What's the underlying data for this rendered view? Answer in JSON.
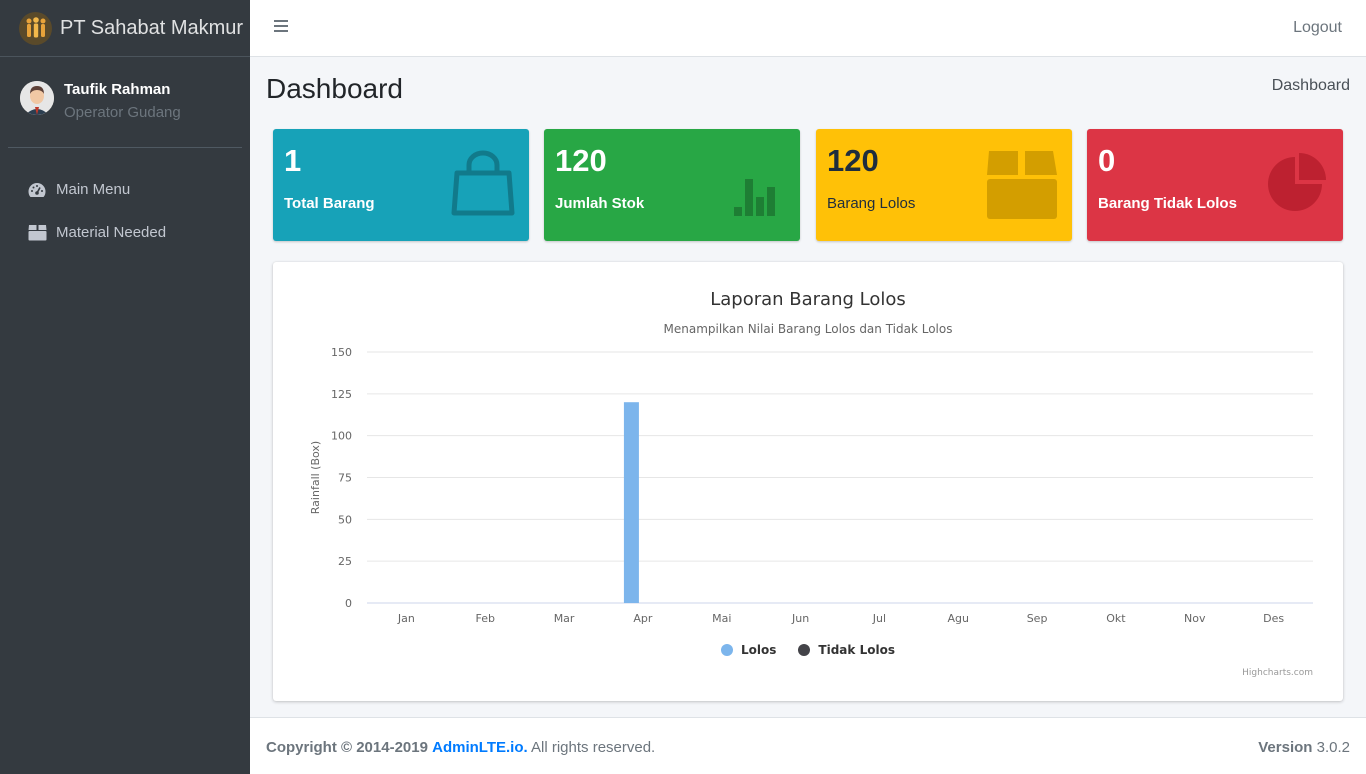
{
  "brand": {
    "name": "PT Sahabat Makmur",
    "logo_icon": "people-group-icon"
  },
  "user": {
    "name": "Taufik Rahman",
    "role": "Operator Gudang"
  },
  "sidebar": {
    "items": [
      {
        "label": "Main Menu",
        "icon": "tachometer-icon"
      },
      {
        "label": "Material Needed",
        "icon": "box-icon"
      }
    ]
  },
  "header": {
    "logout_label": "Logout",
    "menu_icon": "hamburger-icon"
  },
  "page": {
    "title": "Dashboard",
    "breadcrumb": "Dashboard"
  },
  "stats": [
    {
      "value": "1",
      "label": "Total Barang",
      "color": "#17a2b8",
      "icon": "shopping-bag-icon"
    },
    {
      "value": "120",
      "label": "Jumlah Stok",
      "color": "#28a745",
      "icon": "bar-chart-icon"
    },
    {
      "value": "120",
      "label": "Barang Lolos",
      "color": "#ffc107",
      "icon": "archive-box-icon"
    },
    {
      "value": "0",
      "label": "Barang Tidak Lolos",
      "color": "#dc3545",
      "icon": "pie-chart-icon"
    }
  ],
  "chart_data": {
    "type": "bar",
    "title": "Laporan Barang Lolos",
    "subtitle": "Menampilkan Nilai Barang Lolos dan Tidak Lolos",
    "ylabel": "Rainfall (Box)",
    "xlabel": "",
    "ylim": [
      0,
      150
    ],
    "yticks": [
      0,
      25,
      50,
      75,
      100,
      125,
      150
    ],
    "categories": [
      "Jan",
      "Feb",
      "Mar",
      "Apr",
      "Mai",
      "Jun",
      "Jul",
      "Agu",
      "Sep",
      "Okt",
      "Nov",
      "Des"
    ],
    "series": [
      {
        "name": "Lolos",
        "color": "#7cb5ec",
        "values": [
          0,
          0,
          0,
          120,
          0,
          0,
          0,
          0,
          0,
          0,
          0,
          0
        ]
      },
      {
        "name": "Tidak Lolos",
        "color": "#434348",
        "values": [
          0,
          0,
          0,
          0,
          0,
          0,
          0,
          0,
          0,
          0,
          0,
          0
        ]
      }
    ],
    "legend": "bottom-center",
    "grid": true,
    "credit": "Highcharts.com"
  },
  "footer": {
    "copyright_prefix": "Copyright © 2014-2019",
    "link_text": "AdminLTE.io.",
    "suffix": "All rights reserved.",
    "version_label": "Version",
    "version_number": "3.0.2"
  }
}
